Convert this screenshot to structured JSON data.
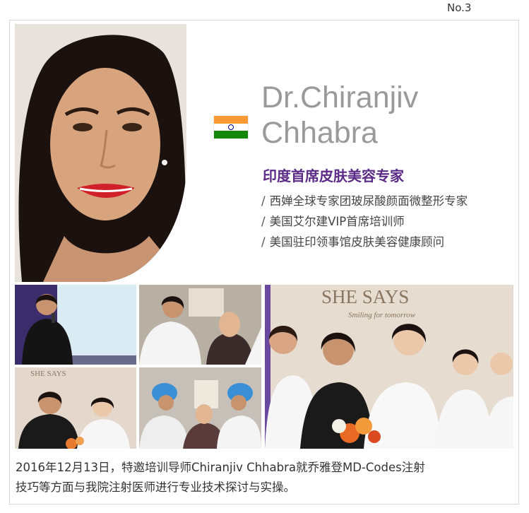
{
  "page_number": "No.3",
  "profile": {
    "name_line1": "Dr.Chiranjiv",
    "name_line2": "Chhabra",
    "country_flag": "india-flag-icon",
    "title": "印度首席皮肤美容专家",
    "credentials": [
      "西婵全球专家团玻尿酸颜面微整形专家",
      "美国艾尔建VIP首席培训师",
      "美国驻印领事馆皮肤美容健康顾问"
    ],
    "bullet": "/"
  },
  "photos": {
    "wall_sign_text": "SHE SAYS",
    "wall_sign_sub": "Smiling for tomorrow",
    "small_sign_text": "SHE SAYS"
  },
  "caption": {
    "line1": "2016年12月13日，特邀培训导师Chiranjiv Chhabra就乔雅登MD-Codes注射",
    "line2": "技巧等方面与我院注射医师进行专业技术探讨与实操。"
  },
  "colors": {
    "title_purple": "#5b2a86",
    "name_gray": "#9a9a9a",
    "flag_saffron": "#ff9933",
    "flag_green": "#138808"
  }
}
